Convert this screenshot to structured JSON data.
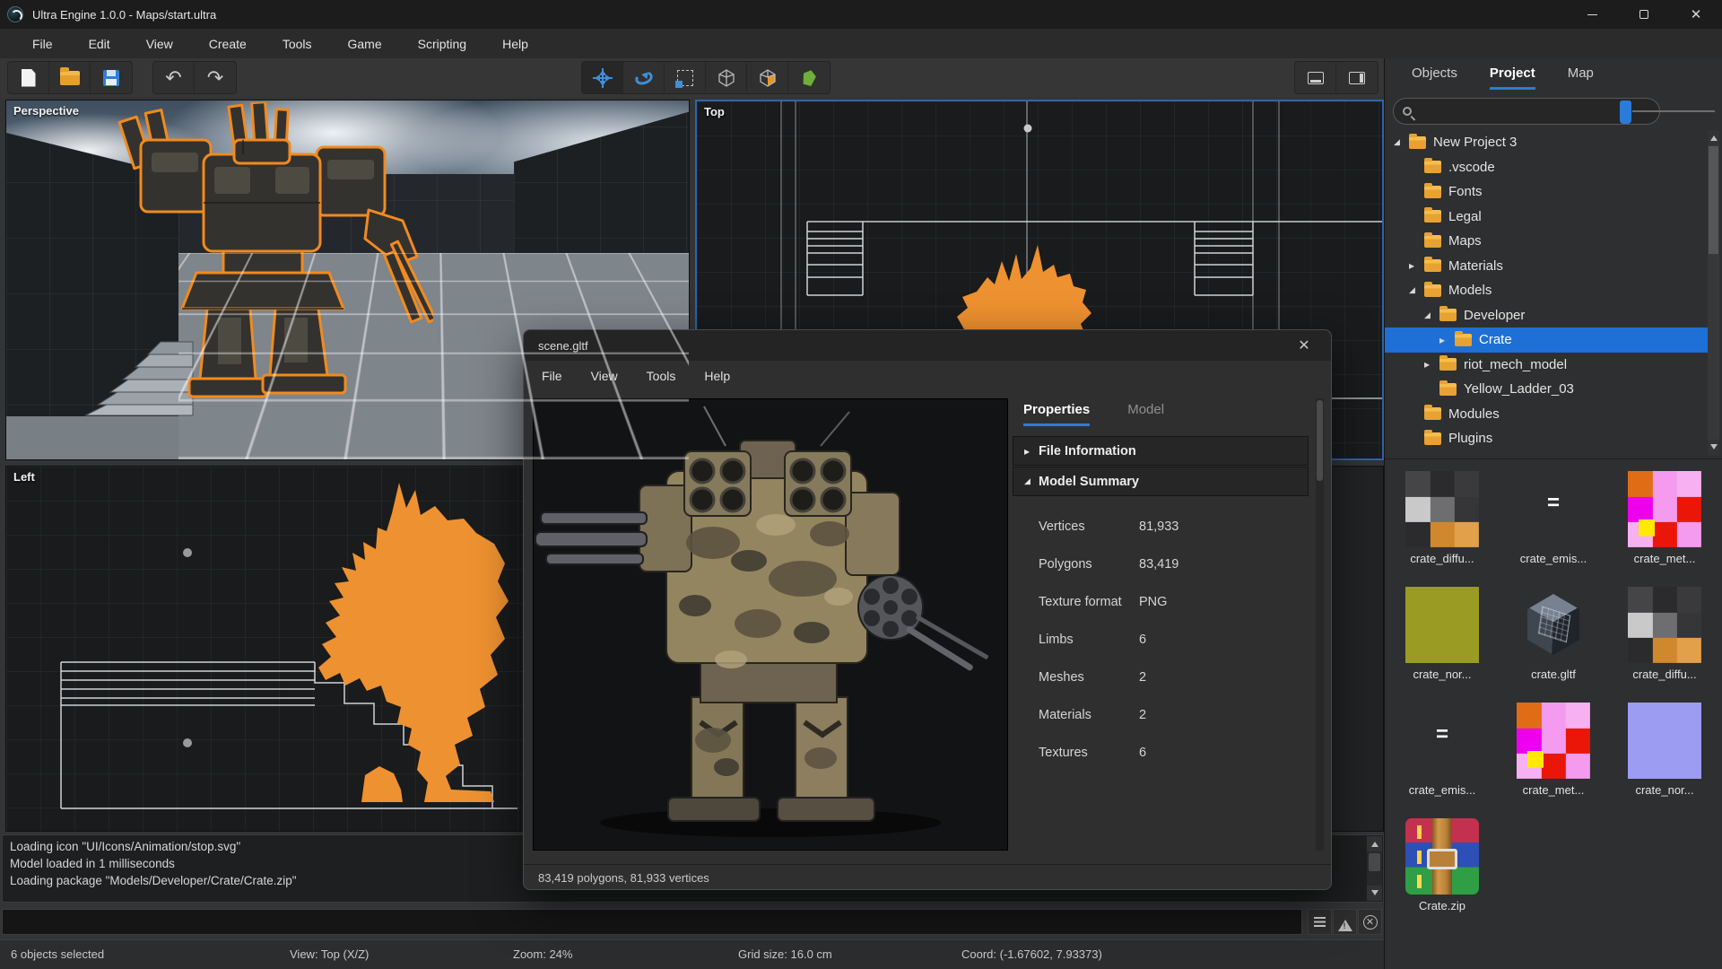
{
  "app": {
    "title": "Ultra Engine 1.0.0 - Maps/start.ultra",
    "window_controls": [
      "minimize",
      "maximize",
      "close"
    ]
  },
  "menu_bar": [
    "File",
    "Edit",
    "View",
    "Create",
    "Tools",
    "Game",
    "Scripting",
    "Help"
  ],
  "toolbar": {
    "file_group": [
      "new-file",
      "open-folder",
      "save"
    ],
    "history_group": [
      "undo",
      "redo"
    ],
    "transform_group": [
      "move-tool",
      "rotate-tool",
      "scale-tool",
      "wireframe-cube",
      "solid-cube",
      "vegetation-tool"
    ],
    "active_tool": "move-tool",
    "layout_group": [
      "toggle-bottom-panel",
      "toggle-right-panel"
    ],
    "undo_glyph": "↶",
    "redo_glyph": "↷"
  },
  "viewports": {
    "perspective": {
      "label": "Perspective"
    },
    "top": {
      "label": "Top",
      "active": true
    },
    "left": {
      "label": "Left"
    }
  },
  "model_window": {
    "title": "scene.gltf",
    "menu": [
      "File",
      "View",
      "Tools",
      "Help"
    ],
    "tabs": [
      {
        "label": "Properties",
        "cls": "active"
      },
      {
        "label": "Model",
        "cls": ""
      }
    ],
    "sections": [
      {
        "label": "File Information",
        "cls": "collapsed sec1"
      },
      {
        "label": "Model Summary",
        "cls": "expanded sec2"
      }
    ],
    "properties": [
      {
        "label": "Vertices",
        "value": "81,933"
      },
      {
        "label": "Polygons",
        "value": "83,419"
      },
      {
        "label": "Texture format",
        "value": "PNG"
      },
      {
        "label": "Limbs",
        "value": "6"
      },
      {
        "label": "Meshes",
        "value": "2"
      },
      {
        "label": "Materials",
        "value": "2"
      },
      {
        "label": "Textures",
        "value": "6"
      }
    ],
    "status": "83,419 polygons, 81,933 vertices"
  },
  "right_panel": {
    "tabs": [
      {
        "label": "Objects",
        "cls": ""
      },
      {
        "label": "Project",
        "cls": "active"
      },
      {
        "label": "Map",
        "cls": ""
      }
    ],
    "search": {
      "value": "",
      "placeholder": ""
    },
    "tree": [
      {
        "label": "New Project 3",
        "cls": "d0 expanded"
      },
      {
        "label": ".vscode",
        "cls": "d1"
      },
      {
        "label": "Fonts",
        "cls": "d1"
      },
      {
        "label": "Legal",
        "cls": "d1"
      },
      {
        "label": "Maps",
        "cls": "d1"
      },
      {
        "label": "Materials",
        "cls": "d1 collapsed"
      },
      {
        "label": "Models",
        "cls": "d1 expanded"
      },
      {
        "label": "Developer",
        "cls": "d2 expanded"
      },
      {
        "label": "Crate",
        "cls": "d3 collapsed selected"
      },
      {
        "label": "riot_mech_model",
        "cls": "d2 collapsed"
      },
      {
        "label": "Yellow_Ladder_03",
        "cls": "d2"
      },
      {
        "label": "Modules",
        "cls": "d1"
      },
      {
        "label": "Plugins",
        "cls": "d1"
      }
    ],
    "assets": [
      {
        "label": "crate_diffu...",
        "cls": "thumb-atlas"
      },
      {
        "label": "crate_emis...",
        "cls": "thumb-emissive"
      },
      {
        "label": "crate_met...",
        "cls": "thumb-metal"
      },
      {
        "label": "crate_nor...",
        "cls": "thumb-normal-olive"
      },
      {
        "label": "crate.gltf",
        "cls": "thumb-cube"
      },
      {
        "label": "crate_diffu...",
        "cls": "thumb-atlas"
      },
      {
        "label": "crate_emis...",
        "cls": "thumb-emissive"
      },
      {
        "label": "crate_met...",
        "cls": "thumb-metal"
      },
      {
        "label": "crate_nor...",
        "cls": "thumb-normal-blue"
      },
      {
        "label": "Crate.zip",
        "cls": "thumb-zip"
      }
    ]
  },
  "console": {
    "lines": [
      "Loading icon \"UI/Icons/Animation/stop.svg\"",
      "Model loaded in 1 milliseconds",
      "Loading package \"Models/Developer/Crate/Crate.zip\""
    ]
  },
  "command_bar": {
    "value": "",
    "buttons": [
      "log-list",
      "warnings",
      "clear"
    ]
  },
  "status_bar": {
    "items": [
      {
        "text": "6 objects selected",
        "cls": "s1"
      },
      {
        "text": "View: Top (X/Z)",
        "cls": "s2"
      },
      {
        "text": "Zoom: 24%",
        "cls": "s3"
      },
      {
        "text": "Grid size: 16.0 cm",
        "cls": "s4"
      },
      {
        "text": "Coord: (-1.67602, 7.93373)",
        "cls": "s5"
      }
    ]
  },
  "colors": {
    "accent_blue": "#2b7cd9",
    "selection_blue": "#1e6fd6",
    "selection_orange": "#f0912c",
    "folder_yellow": "#e7a231"
  }
}
